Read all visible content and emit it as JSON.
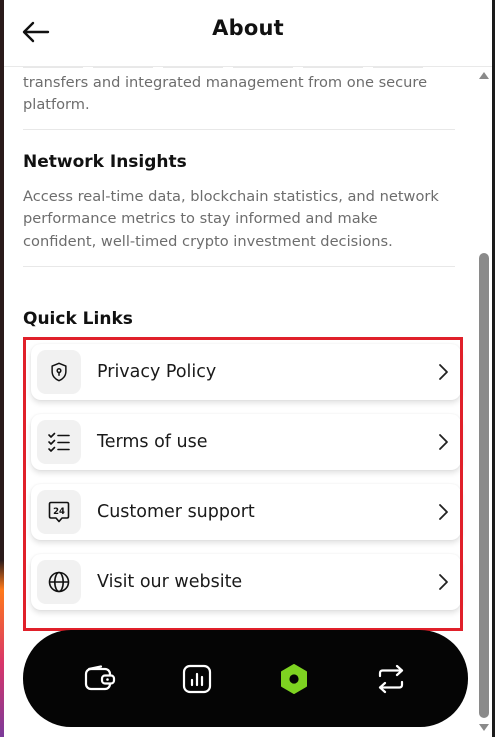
{
  "header": {
    "title": "About",
    "back_icon": "arrow-left-icon"
  },
  "intro": {
    "text": "transfers and integrated management from one secure platform."
  },
  "network_insights": {
    "title": "Network Insights",
    "description": "Access real-time data, blockchain statistics, and network performance metrics to stay informed and make confident, well-timed crypto investment decisions."
  },
  "quick_links": {
    "title": "Quick Links",
    "items": [
      {
        "label": "Privacy Policy",
        "icon": "shield-lock-icon"
      },
      {
        "label": "Terms of use",
        "icon": "checklist-icon"
      },
      {
        "label": "Customer support",
        "icon": "support-24-icon"
      },
      {
        "label": "Visit our website",
        "icon": "globe-icon"
      }
    ]
  },
  "bottom_nav": {
    "items": [
      {
        "icon": "wallet-icon"
      },
      {
        "icon": "chart-icon"
      },
      {
        "icon": "hexagon-icon",
        "active": true
      },
      {
        "icon": "swap-icon"
      }
    ],
    "active_color": "#7ed321"
  },
  "highlight_color": "#e0202a"
}
